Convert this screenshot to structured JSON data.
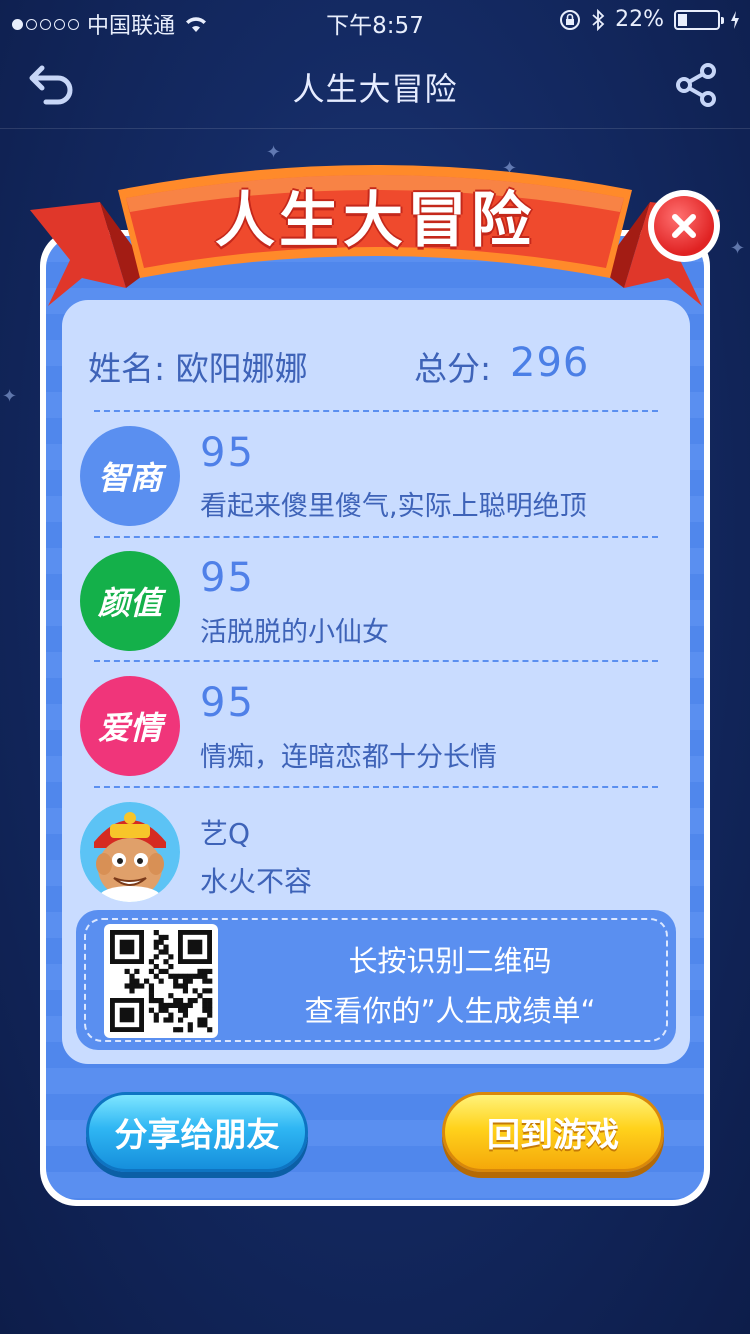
{
  "status_bar": {
    "carrier": "中国联通",
    "time": "下午8:57",
    "battery": "22%"
  },
  "nav": {
    "title": "人生大冒险"
  },
  "card": {
    "banner_title": "人生大冒险",
    "name_label": "姓名: 欧阳娜娜",
    "total_label": "总分:",
    "total_value": "296",
    "traits": [
      {
        "badge": "智商",
        "score": "95",
        "description": "看起来傻里傻气,实际上聪明绝顶",
        "color": "#5a8ff0"
      },
      {
        "badge": "颜值",
        "score": "95",
        "description": "活脱脱的小仙女",
        "color": "#14b04a"
      },
      {
        "badge": "爱情",
        "score": "95",
        "description": "情痴，连暗恋都十分长情",
        "color": "#f0357a"
      }
    ],
    "match": {
      "name": "艺Q",
      "description": "水火不容"
    },
    "qr": {
      "line1": "长按识别二维码",
      "line2": "查看你的”人生成绩单“"
    },
    "buttons": {
      "share": "分享给朋友",
      "back": "回到游戏"
    }
  }
}
